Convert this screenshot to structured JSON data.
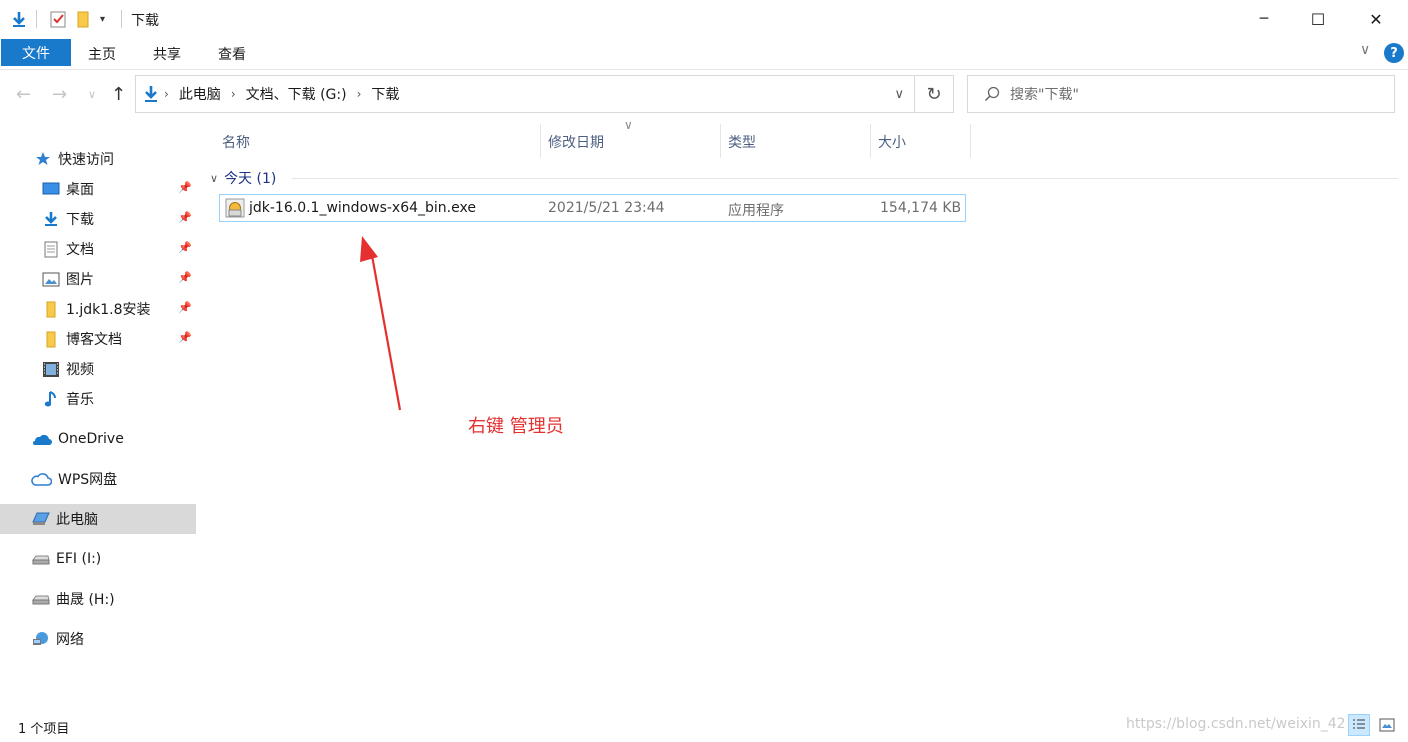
{
  "window": {
    "title": "下载",
    "minimize_label": "─",
    "maximize_label": "☐",
    "close_label": "✕"
  },
  "ribbon": {
    "tabs": [
      {
        "label": "文件"
      },
      {
        "label": "主页"
      },
      {
        "label": "共享"
      },
      {
        "label": "查看"
      }
    ],
    "collapse_label": "∨",
    "help_label": "?"
  },
  "address": {
    "crumbs": [
      "此电脑",
      "文档、下载 (G:)",
      "下载"
    ],
    "search_placeholder": "搜索\"下载\""
  },
  "sidebar": {
    "items": [
      {
        "label": "快速访问",
        "icon": "star-icon"
      },
      {
        "label": "桌面",
        "icon": "desktop-icon",
        "pinned": true
      },
      {
        "label": "下载",
        "icon": "download-icon",
        "pinned": true
      },
      {
        "label": "文档",
        "icon": "document-icon",
        "pinned": true
      },
      {
        "label": "图片",
        "icon": "picture-icon",
        "pinned": true
      },
      {
        "label": "1.jdk1.8安装",
        "icon": "folder-icon",
        "pinned": true
      },
      {
        "label": "博客文档",
        "icon": "folder-icon",
        "pinned": true
      },
      {
        "label": "视频",
        "icon": "video-icon"
      },
      {
        "label": "音乐",
        "icon": "music-icon"
      },
      {
        "label": "OneDrive",
        "icon": "onedrive-icon"
      },
      {
        "label": "WPS网盘",
        "icon": "cloud-icon"
      },
      {
        "label": "此电脑",
        "icon": "computer-icon",
        "selected": true
      },
      {
        "label": "EFI (I:)",
        "icon": "drive-icon"
      },
      {
        "label": "曲晟 (H:)",
        "icon": "drive-icon"
      },
      {
        "label": "网络",
        "icon": "network-icon"
      }
    ]
  },
  "content": {
    "columns": [
      "名称",
      "修改日期",
      "类型",
      "大小"
    ],
    "group_label": "今天 (1)",
    "files": [
      {
        "name": "jdk-16.0.1_windows-x64_bin.exe",
        "date": "2021/5/21 23:44",
        "type": "应用程序",
        "size": "154,174 KB"
      }
    ]
  },
  "annotation": {
    "text": "右键 管理员",
    "color": "#e53030"
  },
  "status": {
    "item_count": "1 个项目",
    "watermark": "https://blog.csdn.net/weixin_42"
  },
  "colors": {
    "accent": "#1979ca",
    "selection_border": "#99d1ff",
    "group_header": "#1e3287"
  }
}
